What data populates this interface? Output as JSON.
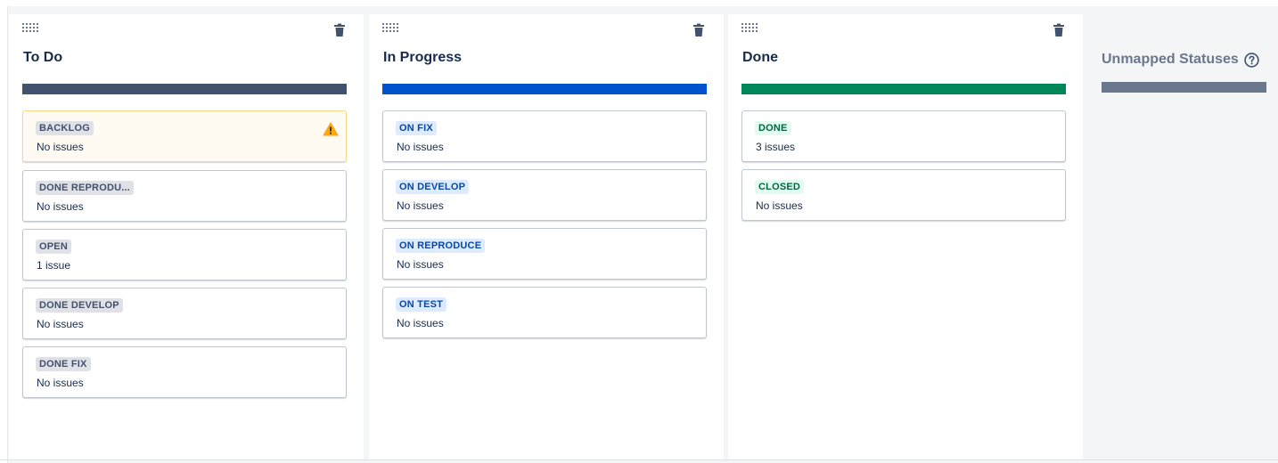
{
  "columns": [
    {
      "title": "To Do",
      "bar_color": "#42526e",
      "cards": [
        {
          "status": "BACKLOG",
          "issues": "No issues",
          "lozenge": "gray",
          "warning": true
        },
        {
          "status": "DONE REPRODU...",
          "issues": "No issues",
          "lozenge": "gray"
        },
        {
          "status": "OPEN",
          "issues": "1 issue",
          "lozenge": "gray"
        },
        {
          "status": "DONE DEVELOP",
          "issues": "No issues",
          "lozenge": "gray"
        },
        {
          "status": "DONE FIX",
          "issues": "No issues",
          "lozenge": "gray"
        }
      ]
    },
    {
      "title": "In Progress",
      "bar_color": "#0052cc",
      "cards": [
        {
          "status": "ON FIX",
          "issues": "No issues",
          "lozenge": "blue"
        },
        {
          "status": "ON DEVELOP",
          "issues": "No issues",
          "lozenge": "blue"
        },
        {
          "status": "ON REPRODUCE",
          "issues": "No issues",
          "lozenge": "blue"
        },
        {
          "status": "ON TEST",
          "issues": "No issues",
          "lozenge": "blue"
        }
      ]
    },
    {
      "title": "Done",
      "bar_color": "#00875a",
      "cards": [
        {
          "status": "DONE",
          "issues": "3 issues",
          "lozenge": "green"
        },
        {
          "status": "CLOSED",
          "issues": "No issues",
          "lozenge": "green"
        }
      ]
    }
  ],
  "unmapped": {
    "title": "Unmapped Statuses",
    "bar_color": "#6b778c"
  },
  "icons": {
    "drag": "drag-handle-icon",
    "delete": "trash-icon",
    "warning": "warning-icon",
    "help": "question-circle-icon"
  }
}
